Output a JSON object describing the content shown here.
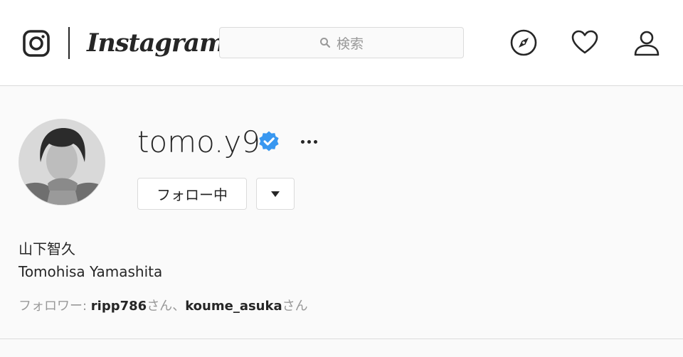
{
  "header": {
    "logo_text": "Instagram",
    "search": {
      "placeholder": "検索"
    },
    "icons": [
      "instagram-glyph-icon",
      "search-icon",
      "explore-compass-icon",
      "heart-icon",
      "profile-icon"
    ]
  },
  "profile": {
    "username": "tomo.y9",
    "verified": true,
    "following_button": "フォロー中",
    "full_name": "山下智久",
    "bio": "Tomohisa Yamashita",
    "followed_by": {
      "prefix": "フォロワー: ",
      "users": [
        "ripp786",
        "koume_asuka"
      ],
      "suffix": "さん",
      "separator": "、"
    }
  },
  "colors": {
    "text": "#262626",
    "muted": "#999999",
    "border": "#dbdbdb",
    "verified_blue": "#3897f0",
    "background": "#fafafa"
  }
}
